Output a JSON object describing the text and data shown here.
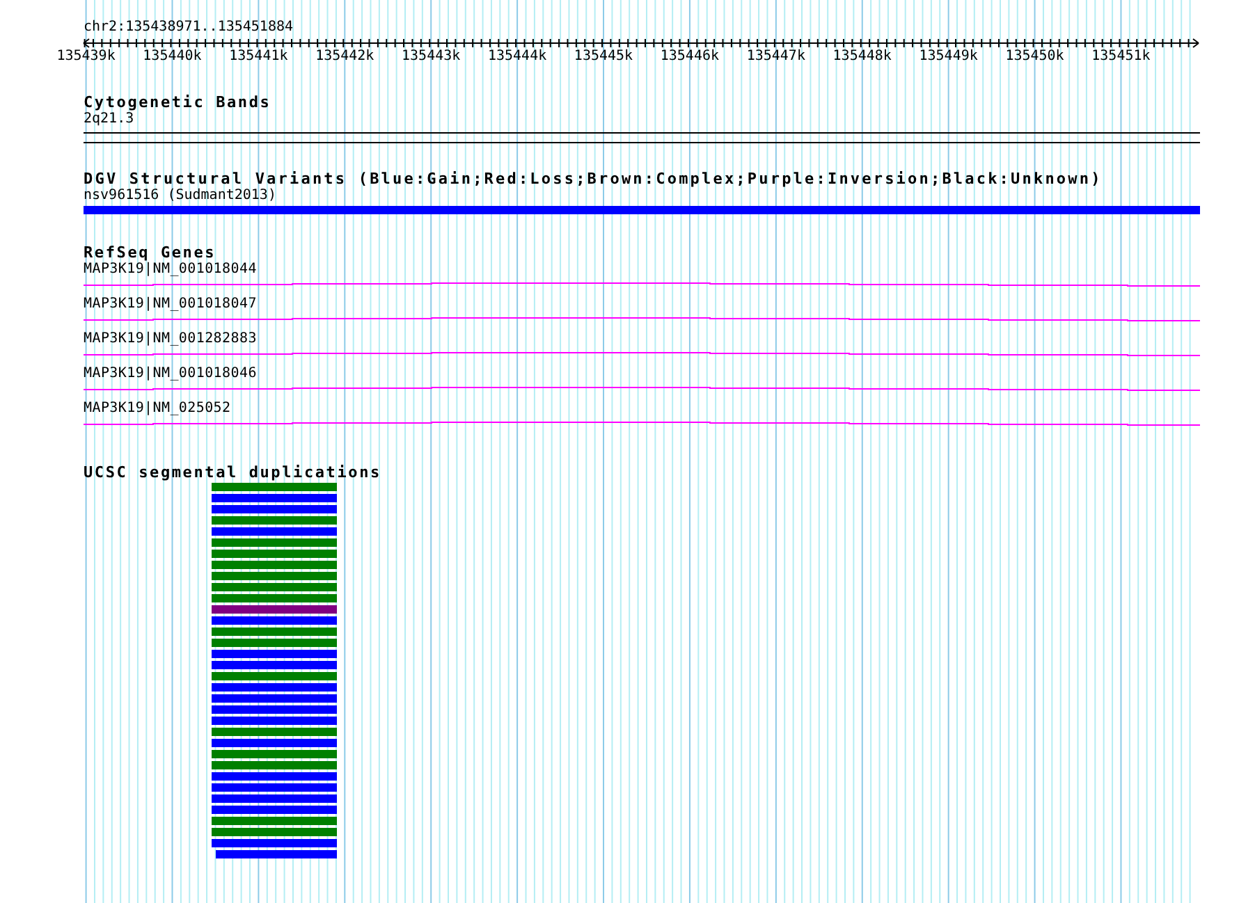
{
  "region": {
    "label": "chr2:135438971..135451884"
  },
  "ruler": {
    "ticks": [
      "135439k",
      "135440k",
      "135441k",
      "135442k",
      "135443k",
      "135444k",
      "135445k",
      "135446k",
      "135447k",
      "135448k",
      "135449k",
      "135450k",
      "135451k"
    ]
  },
  "tracks": [
    {
      "kind": "cytoband",
      "title": "Cytogenetic Bands",
      "features": [
        {
          "label": "2q21.3"
        }
      ]
    },
    {
      "kind": "variant",
      "title": "DGV Structural Variants (Blue:Gain;Red:Loss;Brown:Complex;Purple:Inversion;Black:Unknown)",
      "features": [
        {
          "label": "nsv961516 (Sudmant2013)",
          "color": "#0000ff"
        }
      ]
    },
    {
      "kind": "gene",
      "title": "RefSeq Genes",
      "features": [
        {
          "label": "MAP3K19|NM_001018044"
        },
        {
          "label": "MAP3K19|NM_001018047"
        },
        {
          "label": "MAP3K19|NM_001282883"
        },
        {
          "label": "MAP3K19|NM_001018046"
        },
        {
          "label": "MAP3K19|NM_025052"
        }
      ]
    },
    {
      "kind": "duplication",
      "title": "UCSC segmental duplications",
      "features": [
        {
          "color": "#008000"
        },
        {
          "color": "#0000ff"
        },
        {
          "color": "#0000ff"
        },
        {
          "color": "#008000"
        },
        {
          "color": "#0000ff"
        },
        {
          "color": "#008000"
        },
        {
          "color": "#008000"
        },
        {
          "color": "#008000"
        },
        {
          "color": "#008000"
        },
        {
          "color": "#008000"
        },
        {
          "color": "#008000"
        },
        {
          "color": "#800080"
        },
        {
          "color": "#0000ff"
        },
        {
          "color": "#008000"
        },
        {
          "color": "#008000"
        },
        {
          "color": "#0000ff"
        },
        {
          "color": "#0000ff"
        },
        {
          "color": "#008000"
        },
        {
          "color": "#0000ff"
        },
        {
          "color": "#0000ff"
        },
        {
          "color": "#0000ff"
        },
        {
          "color": "#0000ff"
        },
        {
          "color": "#008000"
        },
        {
          "color": "#0000ff"
        },
        {
          "color": "#008000"
        },
        {
          "color": "#008000"
        },
        {
          "color": "#0000ff"
        },
        {
          "color": "#0000ff"
        },
        {
          "color": "#0000ff"
        },
        {
          "color": "#0000ff"
        },
        {
          "color": "#008000"
        },
        {
          "color": "#008000"
        },
        {
          "color": "#0000ff"
        },
        {
          "color": "#0000ff"
        }
      ]
    }
  ]
}
